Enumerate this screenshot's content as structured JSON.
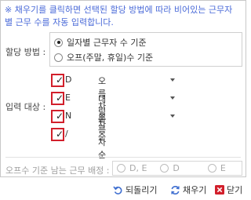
{
  "note": "※ 채우기를 클릭하면 선택된 할당 방법에 따라 비어있는 근무자별 근무 수를 자동 입력합니다.",
  "method": {
    "label": "할당 방법 :",
    "options": [
      "일자별 근무자 수 기준",
      "오프(주말, 휴일)수 기준"
    ],
    "selected_index": 0
  },
  "target": {
    "label": "입력 대상 :",
    "rows": [
      {
        "code": "D",
        "sort": "오름차순",
        "checked": true
      },
      {
        "code": "E",
        "sort": "내림차순",
        "checked": true
      },
      {
        "code": "N",
        "sort": "오름차순",
        "checked": true
      },
      {
        "code": "/",
        "sort": "",
        "checked": true
      }
    ]
  },
  "assign": {
    "label": "오프수 기준 남는 근무 배정 :",
    "options": [
      "D, E",
      "D",
      "E"
    ]
  },
  "footer": {
    "undo_label": "되돌리기",
    "fill_label": "채우기",
    "close_label": "닫기"
  },
  "colors": {
    "note_text": "#4a6ad8",
    "check_border": "#d21f2b",
    "close_icon": "#d21f2b",
    "undo_icon": "#3f6fd0",
    "fill_icon": "#3f6fd0"
  }
}
